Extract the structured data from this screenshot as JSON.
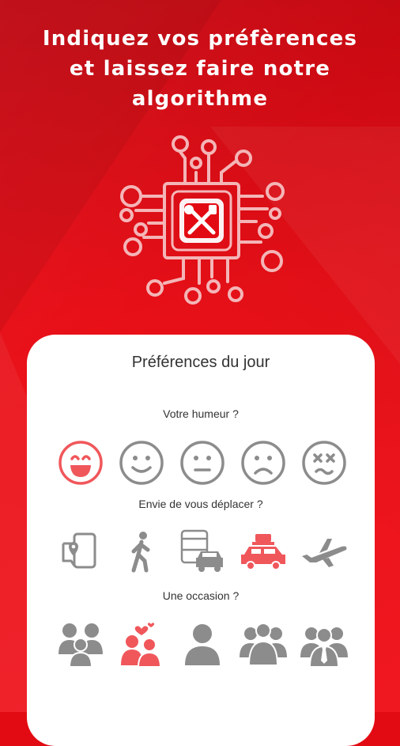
{
  "headline": {
    "line1": "Indiquez vos préfèrences",
    "line2": "et laissez faire notre",
    "line3": "algorithme"
  },
  "colors": {
    "brand_red": "#e30b13",
    "selected": "#f0575b",
    "unselected": "#8c8c8c"
  },
  "card": {
    "title": "Préférences du jour",
    "mood": {
      "question": "Votre humeur ?",
      "options": [
        "very-happy-icon",
        "smile-icon",
        "neutral-face-icon",
        "sad-face-icon",
        "dizzy-face-icon"
      ],
      "selected": "very-happy-icon"
    },
    "travel": {
      "question": "Envie de vous déplacer ?",
      "options": [
        "phone-map-icon",
        "walking-icon",
        "bus-car-icon",
        "car-luggage-icon",
        "airplane-icon"
      ],
      "selected": "car-luggage-icon"
    },
    "occasion": {
      "question": "Une occasion ?",
      "options": [
        "family-icon",
        "couple-hearts-icon",
        "single-person-icon",
        "friends-group-icon",
        "business-people-icon"
      ],
      "selected": "couple-hearts-icon"
    }
  }
}
